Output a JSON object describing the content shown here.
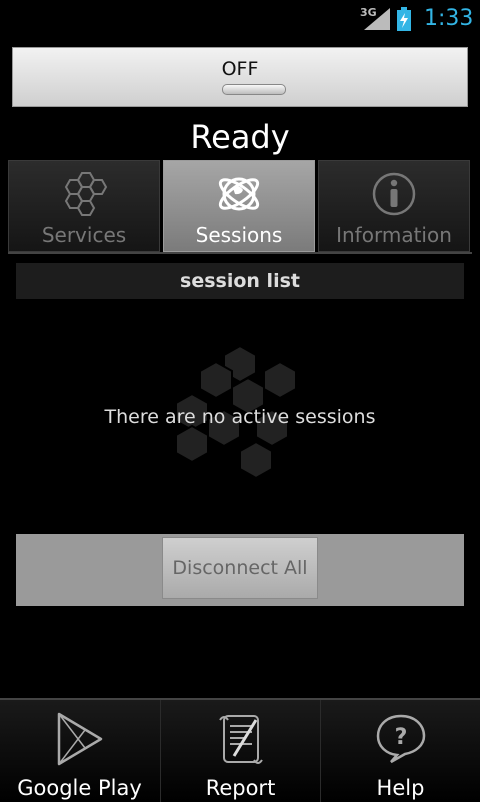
{
  "statusbar": {
    "network": "3G",
    "time": "1:33",
    "time_color": "#33b5e5"
  },
  "toggle": {
    "label": "OFF"
  },
  "status": {
    "text": "Ready"
  },
  "tabs": [
    {
      "label": "Services",
      "icon": "hexagon-cluster-icon",
      "active": false
    },
    {
      "label": "Sessions",
      "icon": "globe-network-icon",
      "active": true
    },
    {
      "label": "Information",
      "icon": "info-icon",
      "active": false
    }
  ],
  "sessions": {
    "header": "session list",
    "empty_message": "There are no active sessions",
    "disconnect_label": "Disconnect All"
  },
  "bottom_nav": [
    {
      "label": "Google Play",
      "icon": "play-store-icon"
    },
    {
      "label": "Report",
      "icon": "report-scroll-icon"
    },
    {
      "label": "Help",
      "icon": "help-bubble-icon"
    }
  ]
}
